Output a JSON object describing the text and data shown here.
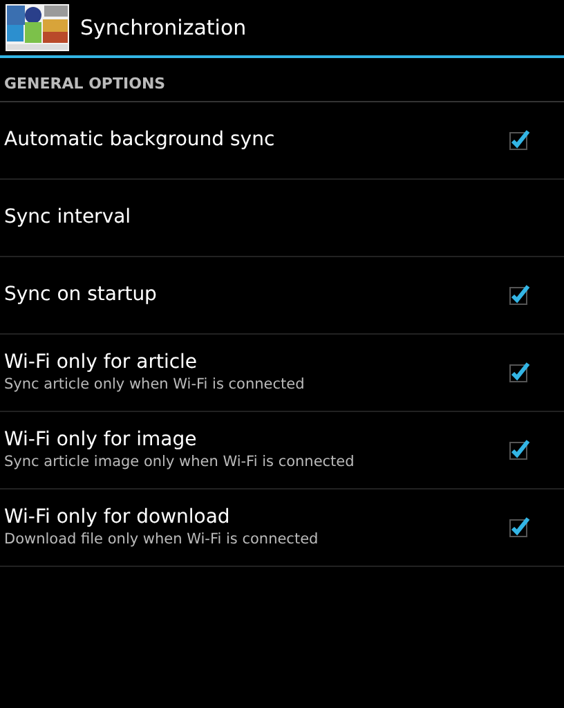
{
  "action_bar": {
    "title": "Synchronization"
  },
  "section": {
    "title": "GENERAL OPTIONS"
  },
  "preferences": [
    {
      "title": "Automatic background sync",
      "kind": "checkbox",
      "checked": true
    },
    {
      "title": "Sync interval",
      "kind": "plain"
    },
    {
      "title": "Sync on startup",
      "kind": "checkbox",
      "checked": true
    },
    {
      "title": "Wi-Fi only for article",
      "summary": "Sync article only when Wi-Fi is connected",
      "kind": "checkbox",
      "checked": true
    },
    {
      "title": "Wi-Fi only for image",
      "summary": "Sync article image only when Wi-Fi is connected",
      "kind": "checkbox",
      "checked": true
    },
    {
      "title": "Wi-Fi only for download",
      "summary": "Download file only when Wi-Fi is connected",
      "kind": "checkbox",
      "checked": true
    }
  ]
}
